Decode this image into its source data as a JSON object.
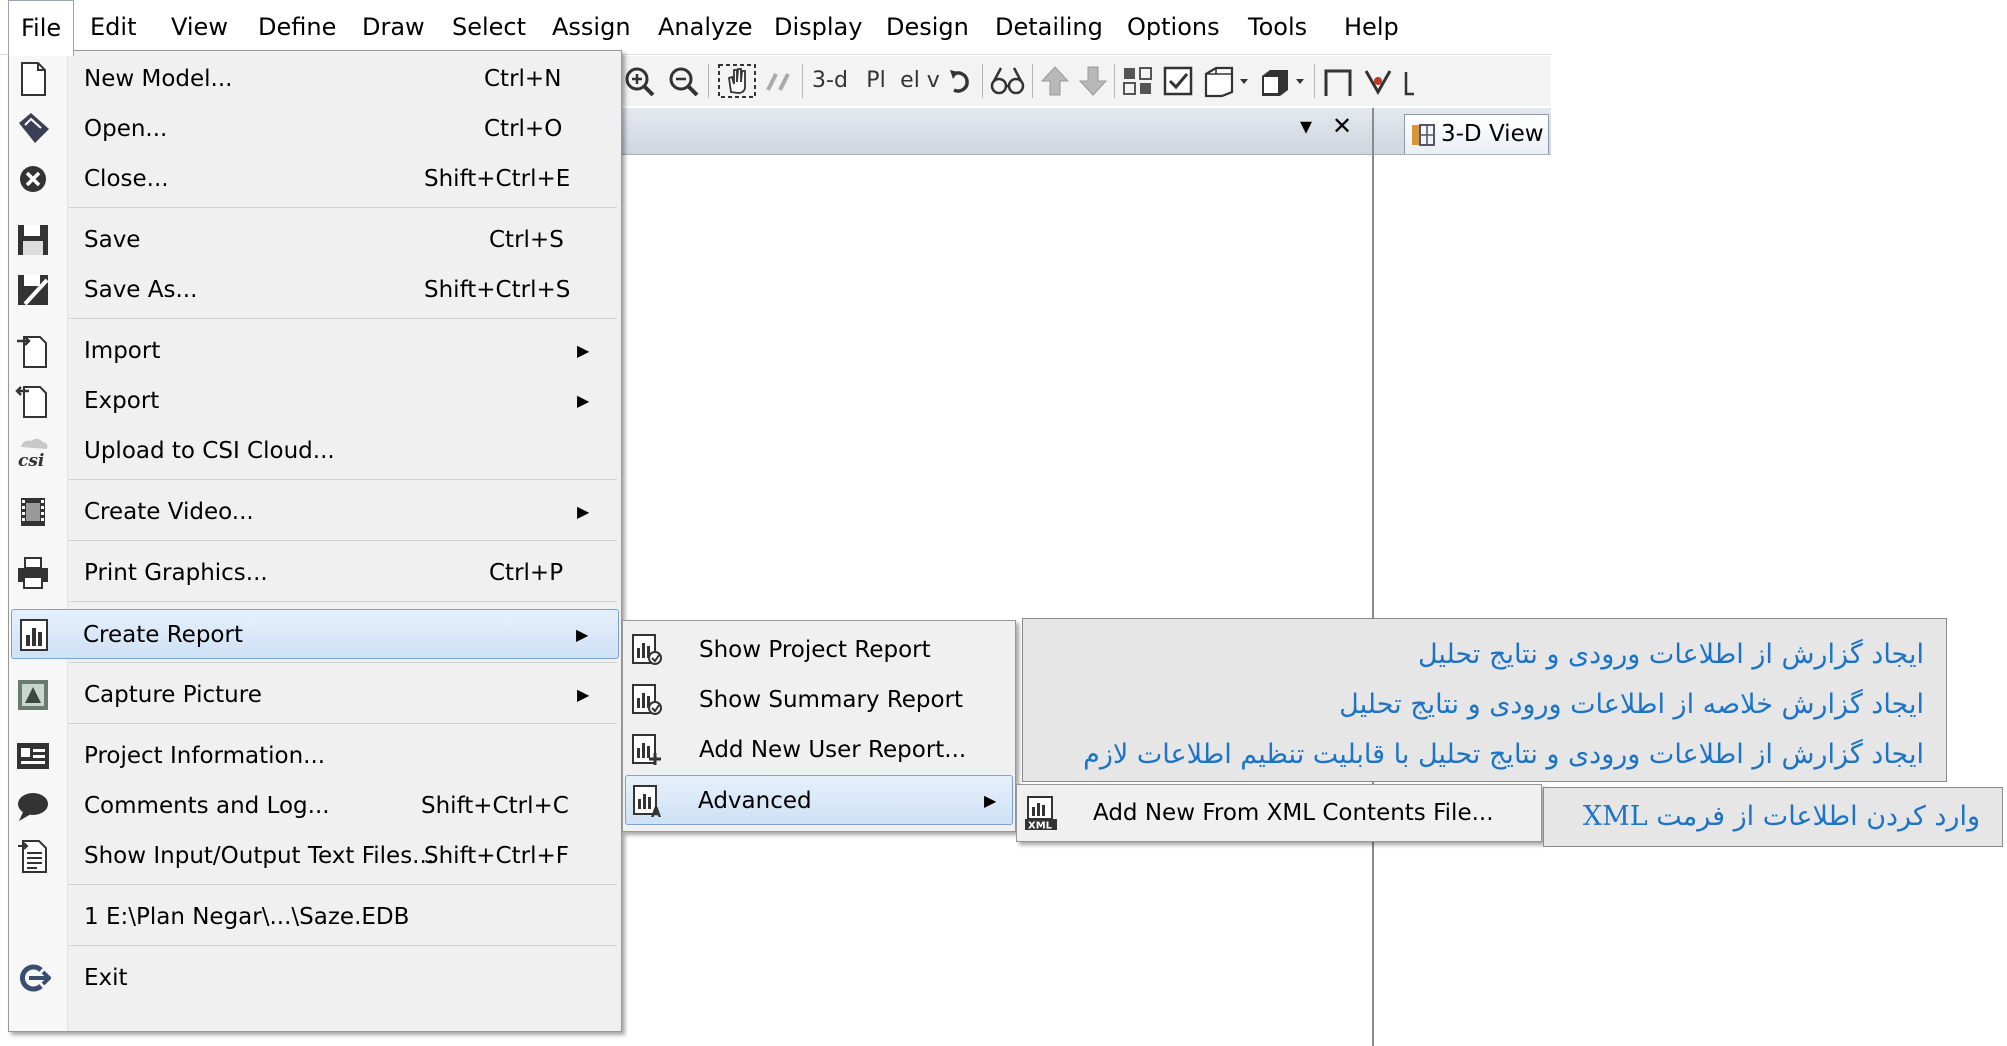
{
  "menubar": {
    "items": [
      "File",
      "Edit",
      "View",
      "Define",
      "Draw",
      "Select",
      "Assign",
      "Analyze",
      "Display",
      "Design",
      "Detailing",
      "Options",
      "Tools",
      "Help"
    ]
  },
  "toolbar": {
    "view_3d": "3-d",
    "plan": "Pl n",
    "elev": "el v"
  },
  "panes": {
    "right_tab_label": "3-D View",
    "close_glyph": "✕",
    "dropdown_glyph": "▾"
  },
  "file_menu": {
    "items": [
      {
        "label": "New Model...",
        "shortcut": "Ctrl+N",
        "icon": "new-page-icon"
      },
      {
        "label": "Open...",
        "shortcut": "Ctrl+O",
        "icon": "open-icon"
      },
      {
        "label": "Close...",
        "shortcut": "Shift+Ctrl+E",
        "icon": "close-circle-icon"
      },
      {
        "label": "Save",
        "shortcut": "Ctrl+S",
        "icon": "floppy-icon"
      },
      {
        "label": "Save As...",
        "shortcut": "Shift+Ctrl+S",
        "icon": "floppy-pencil-icon"
      },
      {
        "label": "Import",
        "shortcut": "",
        "icon": "import-icon",
        "submenu": true
      },
      {
        "label": "Export",
        "shortcut": "",
        "icon": "export-icon",
        "submenu": true
      },
      {
        "label": "Upload to CSI Cloud...",
        "shortcut": "",
        "icon": "csi-cloud-icon"
      },
      {
        "label": "Create Video...",
        "shortcut": "",
        "icon": "film-icon",
        "submenu": true
      },
      {
        "label": "Print Graphics...",
        "shortcut": "Ctrl+P",
        "icon": "printer-icon"
      },
      {
        "label": "Create Report",
        "shortcut": "",
        "icon": "report-chart-icon",
        "submenu": true
      },
      {
        "label": "Capture Picture",
        "shortcut": "",
        "icon": "picture-icon",
        "submenu": true
      },
      {
        "label": "Project Information...",
        "shortcut": "",
        "icon": "info-card-icon"
      },
      {
        "label": "Comments and Log...",
        "shortcut": "Shift+Ctrl+C",
        "icon": "speech-bubble-icon"
      },
      {
        "label": "Show Input/Output Text Files...",
        "shortcut": "Shift+Ctrl+F",
        "icon": "text-file-icon"
      },
      {
        "label": "1 E:\\Plan Negar\\...\\Saze.EDB",
        "shortcut": "",
        "icon": ""
      },
      {
        "label": "Exit",
        "shortcut": "",
        "icon": "exit-icon"
      }
    ]
  },
  "report_menu": {
    "items": [
      {
        "label": "Show Project Report",
        "icon": "report-view-icon"
      },
      {
        "label": "Show Summary Report",
        "icon": "report-view-icon"
      },
      {
        "label": "Add New User Report...",
        "icon": "report-add-icon"
      },
      {
        "label": "Advanced",
        "icon": "report-advanced-icon",
        "submenu": true
      }
    ]
  },
  "advanced_menu": {
    "items": [
      {
        "label": "Add New From XML Contents File...",
        "icon": "xml-file-icon"
      }
    ]
  },
  "annotations": {
    "report_lines": [
      "ایجاد گزارش از اطلاعات ورودی و نتایج تحلیل",
      "ایجاد گزارش خلاصه از اطلاعات ورودی و نتایج تحلیل",
      "ایجاد گزارش از اطلاعات ورودی و نتایج تحلیل با قابلیت تنظیم اطلاعات لازم"
    ],
    "xml_line": "وارد کردن اطلاعات از فرمت XML"
  },
  "colors": {
    "annotation_text": "#1b74c7",
    "highlight": "#cfe1f5"
  }
}
